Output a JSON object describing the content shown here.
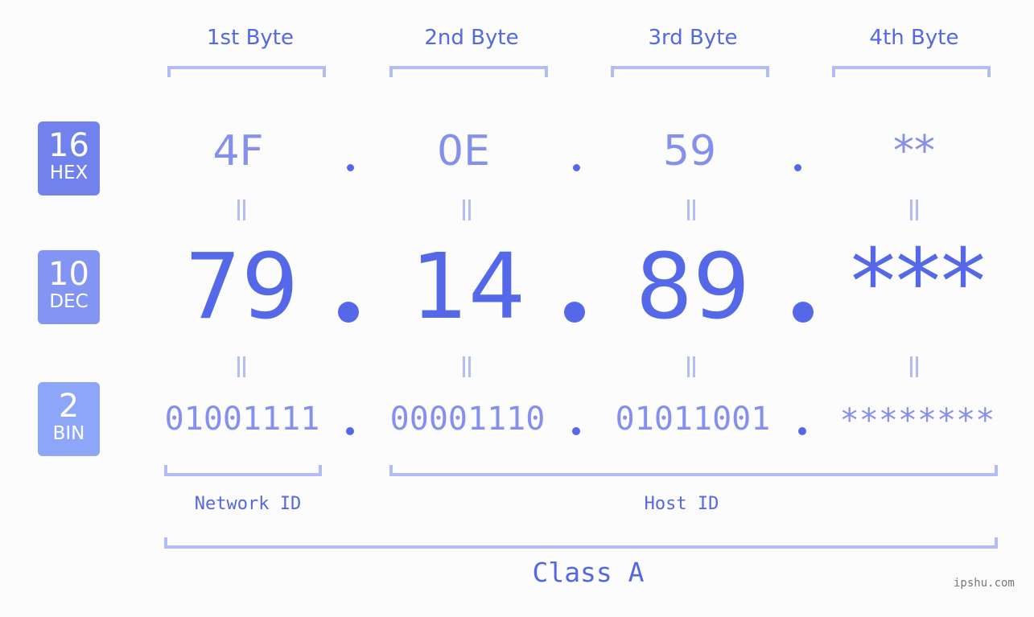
{
  "bytes": [
    {
      "title": "1st Byte",
      "hex": "4F",
      "dec": "79",
      "bin": "01001111"
    },
    {
      "title": "2nd Byte",
      "hex": "0E",
      "dec": "14",
      "bin": "00001110"
    },
    {
      "title": "3rd Byte",
      "hex": "59",
      "dec": "89",
      "bin": "01011001"
    },
    {
      "title": "4th Byte",
      "hex": "**",
      "dec": "***",
      "bin": "********"
    }
  ],
  "badges": {
    "hex": {
      "num": "16",
      "label": "HEX",
      "color": "#7282ec"
    },
    "dec": {
      "num": "10",
      "label": "DEC",
      "color": "#8494f2"
    },
    "bin": {
      "num": "2",
      "label": "BIN",
      "color": "#8ea6f8"
    }
  },
  "segments": {
    "network": "Network ID",
    "host": "Host ID"
  },
  "ip_class": "Class A",
  "watermark": "ipshu.com",
  "colors": {
    "accent": "#5468e8",
    "light_accent": "#8590ec",
    "bracket": "#b3bcf5"
  }
}
